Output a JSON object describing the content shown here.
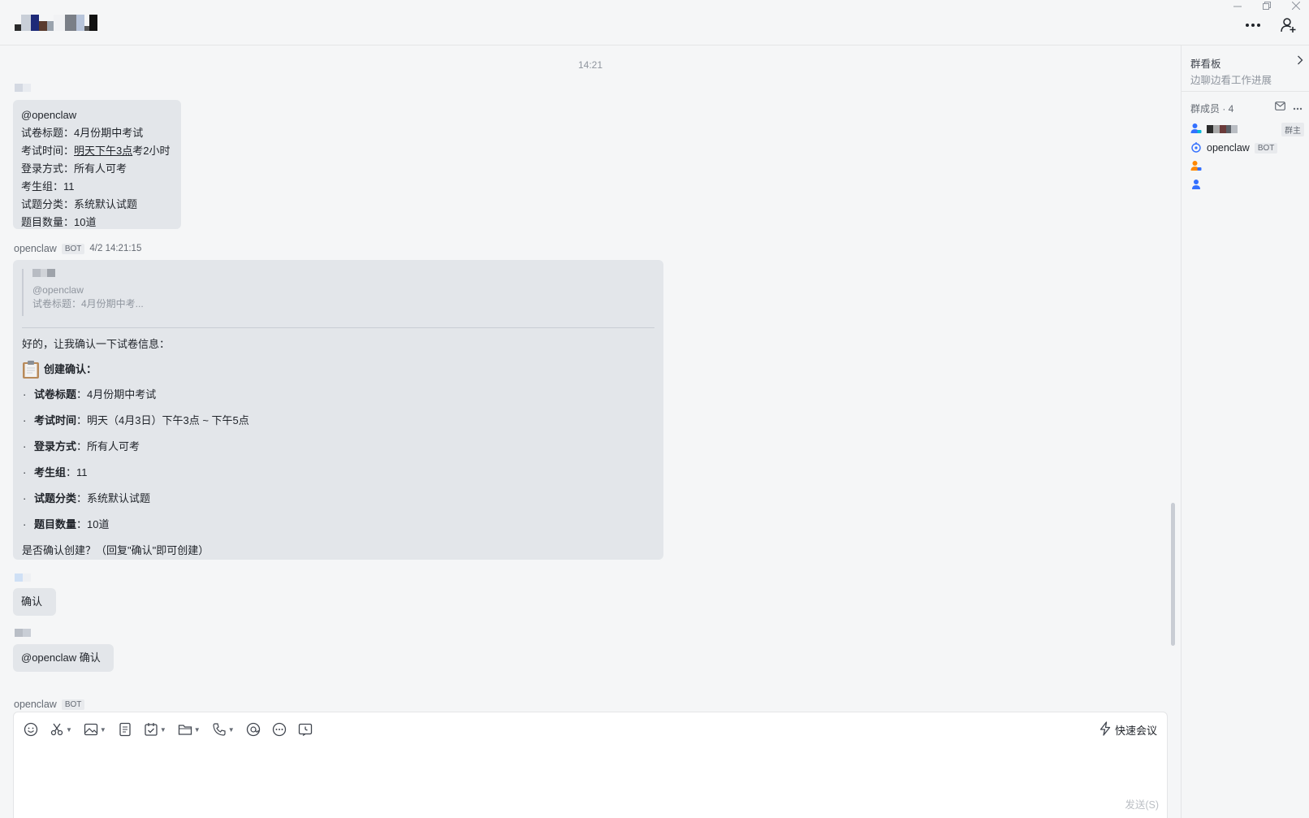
{
  "header": {
    "more_icon": "more-horizontal-icon",
    "add_member_icon": "add-user-icon"
  },
  "chat": {
    "time_divider": "14:21",
    "messages": [
      {
        "lines": [
          "@openclaw",
          "试卷标题：4月份期中考试",
          "考试时间：",
          "明天下午3点",
          "考2小时",
          "登录方式：所有人可考",
          "考生组：11",
          "试题分类：系统默认试题",
          "题目数量：10道"
        ]
      },
      {
        "sender": "openclaw",
        "badge": "BOT",
        "time": "4/2 14:21:15",
        "quote_lines": [
          "@openclaw",
          "试卷标题：4月份期中考..."
        ],
        "intro": "好的，让我确认一下试卷信息：",
        "heading": "创建确认：",
        "bullets": [
          {
            "key": "试卷标题",
            "value": "：4月份期中考试"
          },
          {
            "key": "考试时间",
            "value": "：明天（4月3日）下午3点 ~ 下午5点"
          },
          {
            "key": "登录方式",
            "value": "：所有人可考"
          },
          {
            "key": "考生组",
            "value": "：11"
          },
          {
            "key": "试题分类",
            "value": "：系统默认试题"
          },
          {
            "key": "题目数量",
            "value": "：10道"
          }
        ],
        "bullet_char": "·",
        "ask": "是否确认创建？（回复\"确认\"即可创建）"
      },
      {
        "text": "确认"
      },
      {
        "text": "@openclaw 确认"
      },
      {
        "sender": "openclaw",
        "badge": "BOT"
      }
    ]
  },
  "composer": {
    "tools": [
      "emoji-icon",
      "scissors-icon",
      "image-icon",
      "document-icon",
      "task-icon",
      "folder-icon",
      "phone-icon",
      "mention-icon",
      "more-circle-icon",
      "schedule-icon"
    ],
    "quick_meeting": "快速会议",
    "send": "发送(S)"
  },
  "side": {
    "board_title": "群看板",
    "board_sub": "边聊边看工作进展",
    "members_label": "群成员 · 4",
    "members": [
      {
        "name": "",
        "tag": "群主",
        "icon": "user-icon-blue"
      },
      {
        "name": "openclaw",
        "tag": "BOT",
        "icon": "bot-icon"
      },
      {
        "name": "",
        "icon": "user-icon-orange"
      },
      {
        "name": "",
        "icon": "user-icon-blue"
      }
    ]
  },
  "colors": {
    "background": "#f5f6f7",
    "bubble": "#e3e6ea",
    "accent_blue": "#3370ff",
    "accent_orange": "#ff8800"
  }
}
